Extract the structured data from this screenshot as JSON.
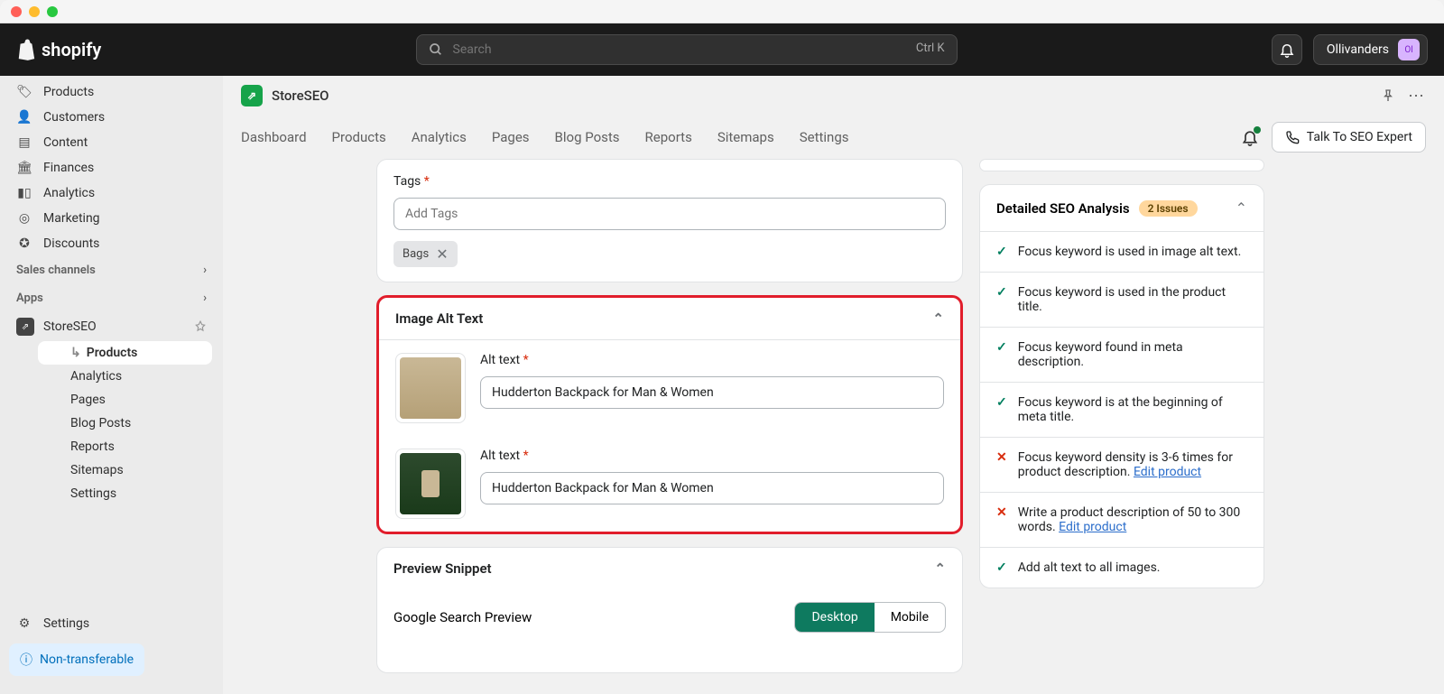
{
  "brand": "shopify",
  "search": {
    "placeholder": "Search",
    "shortcut": "Ctrl K"
  },
  "user": {
    "name": "Ollivanders",
    "initials": "Ol"
  },
  "sidebar": {
    "main": [
      {
        "label": "Products"
      },
      {
        "label": "Customers"
      },
      {
        "label": "Content"
      },
      {
        "label": "Finances"
      },
      {
        "label": "Analytics"
      },
      {
        "label": "Marketing"
      },
      {
        "label": "Discounts"
      }
    ],
    "salesChannelsLabel": "Sales channels",
    "appsLabel": "Apps",
    "app": {
      "name": "StoreSEO"
    },
    "appSub": [
      "Products",
      "Analytics",
      "Pages",
      "Blog Posts",
      "Reports",
      "Sitemaps",
      "Settings"
    ],
    "settings": "Settings",
    "badge": "Non-transferable"
  },
  "appHeader": {
    "title": "StoreSEO"
  },
  "tabs": [
    "Dashboard",
    "Products",
    "Analytics",
    "Pages",
    "Blog Posts",
    "Reports",
    "Sitemaps",
    "Settings"
  ],
  "expertBtn": "Talk To SEO Expert",
  "tags": {
    "label": "Tags",
    "placeholder": "Add Tags",
    "chips": [
      "Bags"
    ]
  },
  "imageAlt": {
    "title": "Image Alt Text",
    "labelText": "Alt text",
    "items": [
      {
        "value": "Hudderton Backpack for Man & Women",
        "thumbClass": "thumb-bag"
      },
      {
        "value": "Hudderton Backpack for Man & Women",
        "thumbClass": "thumb-forest"
      }
    ]
  },
  "preview": {
    "title": "Preview Snippet",
    "googleLabel": "Google Search Preview",
    "options": [
      "Desktop",
      "Mobile"
    ]
  },
  "analysis": {
    "title": "Detailed SEO Analysis",
    "issuesLabel": "2 Issues",
    "items": [
      {
        "status": "ok",
        "text": "Focus keyword is used in image alt text."
      },
      {
        "status": "ok",
        "text": "Focus keyword is used in the product title."
      },
      {
        "status": "ok",
        "text": "Focus keyword found in meta description."
      },
      {
        "status": "ok",
        "text": "Focus keyword is at the beginning of meta title."
      },
      {
        "status": "fail",
        "text": "Focus keyword density is 3-6 times for product description. ",
        "link": "Edit product"
      },
      {
        "status": "fail",
        "text": "Write a product description of 50 to 300 words. ",
        "link": "Edit product"
      },
      {
        "status": "ok",
        "text": "Add alt text to all images."
      }
    ]
  }
}
